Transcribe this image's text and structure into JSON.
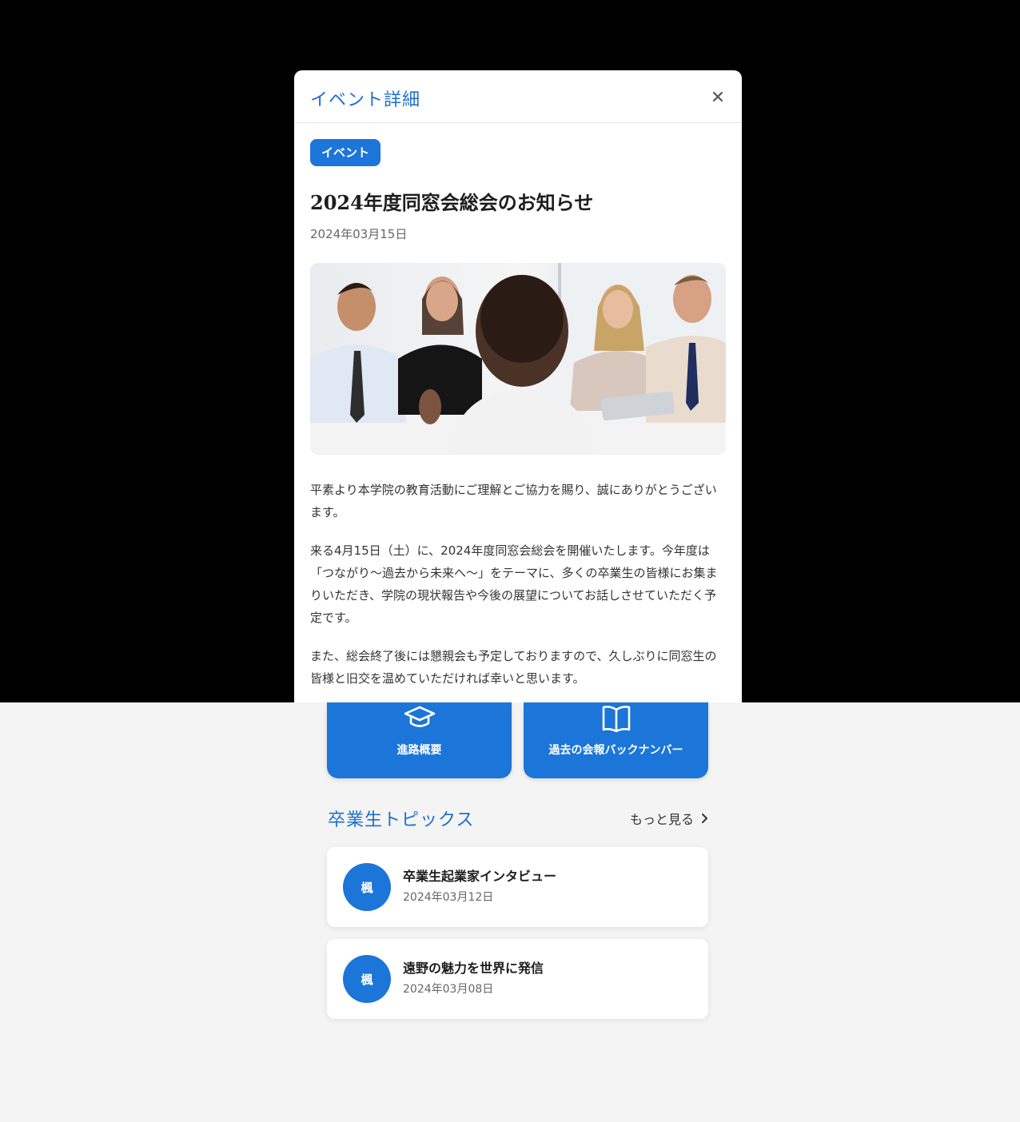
{
  "modal": {
    "title": "イベント詳細",
    "close_label": "×",
    "tag": "イベント",
    "event_title": "2024年度同窓会総会のお知らせ",
    "event_date": "2024年03月15日",
    "photo_alt": "会議中の人々",
    "paragraphs": [
      "平素より本学院の教育活動にご理解とご協力を賜り、誠にありがとうございます。",
      "来る4月15日（土）に、2024年度同窓会総会を開催いたします。今年度は「つながり〜過去から未来へ〜」をテーマに、多くの卒業生の皆様にお集まりいただき、学院の現状報告や今後の展望についてお話しさせていただく予定です。",
      "また、総会終了後には懇親会も予定しておりますので、久しぶりに同窓生の皆様と旧交を温めていただければ幸いと思います。"
    ]
  },
  "quick_links": [
    {
      "label": "進路概要",
      "icon": "graduation-cap-icon"
    },
    {
      "label": "過去の会報バックナンバー",
      "icon": "open-book-icon"
    }
  ],
  "topics_section": {
    "title": "卒業生トピックス",
    "more_label": "もっと見る",
    "items": [
      {
        "avatar": "楓",
        "title": "卒業生起業家インタビュー",
        "date": "2024年03月12日"
      },
      {
        "avatar": "楓",
        "title": "遠野の魅力を世界に発信",
        "date": "2024年03月08日"
      }
    ]
  },
  "colors": {
    "accent": "#1c75d8",
    "title_blue": "#1c6fcc",
    "backdrop": "#000000",
    "page_bg": "#f4f4f4"
  }
}
